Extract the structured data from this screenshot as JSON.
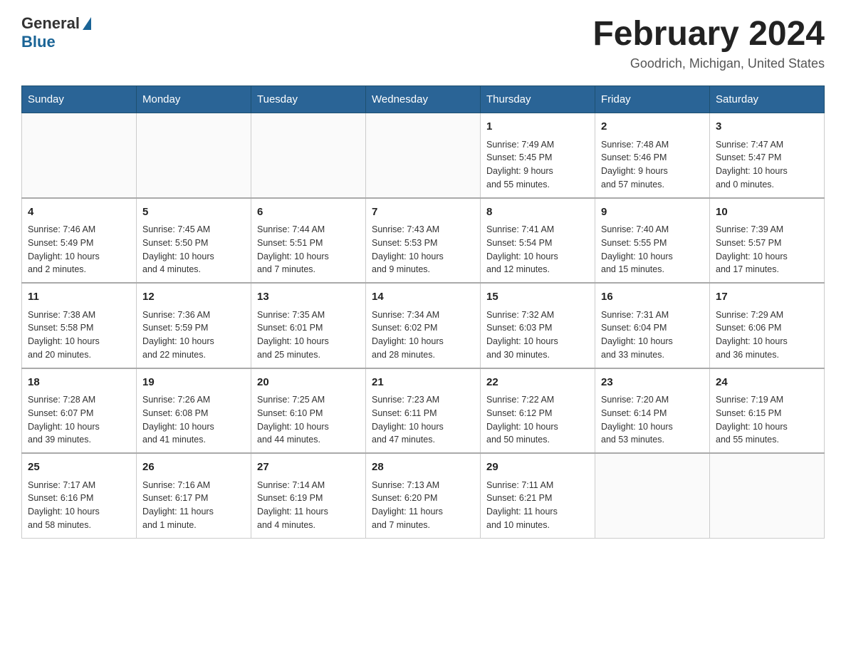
{
  "header": {
    "logo_general": "General",
    "logo_blue": "Blue",
    "title": "February 2024",
    "location": "Goodrich, Michigan, United States"
  },
  "weekdays": [
    "Sunday",
    "Monday",
    "Tuesday",
    "Wednesday",
    "Thursday",
    "Friday",
    "Saturday"
  ],
  "weeks": [
    [
      {
        "day": "",
        "info": ""
      },
      {
        "day": "",
        "info": ""
      },
      {
        "day": "",
        "info": ""
      },
      {
        "day": "",
        "info": ""
      },
      {
        "day": "1",
        "info": "Sunrise: 7:49 AM\nSunset: 5:45 PM\nDaylight: 9 hours\nand 55 minutes."
      },
      {
        "day": "2",
        "info": "Sunrise: 7:48 AM\nSunset: 5:46 PM\nDaylight: 9 hours\nand 57 minutes."
      },
      {
        "day": "3",
        "info": "Sunrise: 7:47 AM\nSunset: 5:47 PM\nDaylight: 10 hours\nand 0 minutes."
      }
    ],
    [
      {
        "day": "4",
        "info": "Sunrise: 7:46 AM\nSunset: 5:49 PM\nDaylight: 10 hours\nand 2 minutes."
      },
      {
        "day": "5",
        "info": "Sunrise: 7:45 AM\nSunset: 5:50 PM\nDaylight: 10 hours\nand 4 minutes."
      },
      {
        "day": "6",
        "info": "Sunrise: 7:44 AM\nSunset: 5:51 PM\nDaylight: 10 hours\nand 7 minutes."
      },
      {
        "day": "7",
        "info": "Sunrise: 7:43 AM\nSunset: 5:53 PM\nDaylight: 10 hours\nand 9 minutes."
      },
      {
        "day": "8",
        "info": "Sunrise: 7:41 AM\nSunset: 5:54 PM\nDaylight: 10 hours\nand 12 minutes."
      },
      {
        "day": "9",
        "info": "Sunrise: 7:40 AM\nSunset: 5:55 PM\nDaylight: 10 hours\nand 15 minutes."
      },
      {
        "day": "10",
        "info": "Sunrise: 7:39 AM\nSunset: 5:57 PM\nDaylight: 10 hours\nand 17 minutes."
      }
    ],
    [
      {
        "day": "11",
        "info": "Sunrise: 7:38 AM\nSunset: 5:58 PM\nDaylight: 10 hours\nand 20 minutes."
      },
      {
        "day": "12",
        "info": "Sunrise: 7:36 AM\nSunset: 5:59 PM\nDaylight: 10 hours\nand 22 minutes."
      },
      {
        "day": "13",
        "info": "Sunrise: 7:35 AM\nSunset: 6:01 PM\nDaylight: 10 hours\nand 25 minutes."
      },
      {
        "day": "14",
        "info": "Sunrise: 7:34 AM\nSunset: 6:02 PM\nDaylight: 10 hours\nand 28 minutes."
      },
      {
        "day": "15",
        "info": "Sunrise: 7:32 AM\nSunset: 6:03 PM\nDaylight: 10 hours\nand 30 minutes."
      },
      {
        "day": "16",
        "info": "Sunrise: 7:31 AM\nSunset: 6:04 PM\nDaylight: 10 hours\nand 33 minutes."
      },
      {
        "day": "17",
        "info": "Sunrise: 7:29 AM\nSunset: 6:06 PM\nDaylight: 10 hours\nand 36 minutes."
      }
    ],
    [
      {
        "day": "18",
        "info": "Sunrise: 7:28 AM\nSunset: 6:07 PM\nDaylight: 10 hours\nand 39 minutes."
      },
      {
        "day": "19",
        "info": "Sunrise: 7:26 AM\nSunset: 6:08 PM\nDaylight: 10 hours\nand 41 minutes."
      },
      {
        "day": "20",
        "info": "Sunrise: 7:25 AM\nSunset: 6:10 PM\nDaylight: 10 hours\nand 44 minutes."
      },
      {
        "day": "21",
        "info": "Sunrise: 7:23 AM\nSunset: 6:11 PM\nDaylight: 10 hours\nand 47 minutes."
      },
      {
        "day": "22",
        "info": "Sunrise: 7:22 AM\nSunset: 6:12 PM\nDaylight: 10 hours\nand 50 minutes."
      },
      {
        "day": "23",
        "info": "Sunrise: 7:20 AM\nSunset: 6:14 PM\nDaylight: 10 hours\nand 53 minutes."
      },
      {
        "day": "24",
        "info": "Sunrise: 7:19 AM\nSunset: 6:15 PM\nDaylight: 10 hours\nand 55 minutes."
      }
    ],
    [
      {
        "day": "25",
        "info": "Sunrise: 7:17 AM\nSunset: 6:16 PM\nDaylight: 10 hours\nand 58 minutes."
      },
      {
        "day": "26",
        "info": "Sunrise: 7:16 AM\nSunset: 6:17 PM\nDaylight: 11 hours\nand 1 minute."
      },
      {
        "day": "27",
        "info": "Sunrise: 7:14 AM\nSunset: 6:19 PM\nDaylight: 11 hours\nand 4 minutes."
      },
      {
        "day": "28",
        "info": "Sunrise: 7:13 AM\nSunset: 6:20 PM\nDaylight: 11 hours\nand 7 minutes."
      },
      {
        "day": "29",
        "info": "Sunrise: 7:11 AM\nSunset: 6:21 PM\nDaylight: 11 hours\nand 10 minutes."
      },
      {
        "day": "",
        "info": ""
      },
      {
        "day": "",
        "info": ""
      }
    ]
  ]
}
